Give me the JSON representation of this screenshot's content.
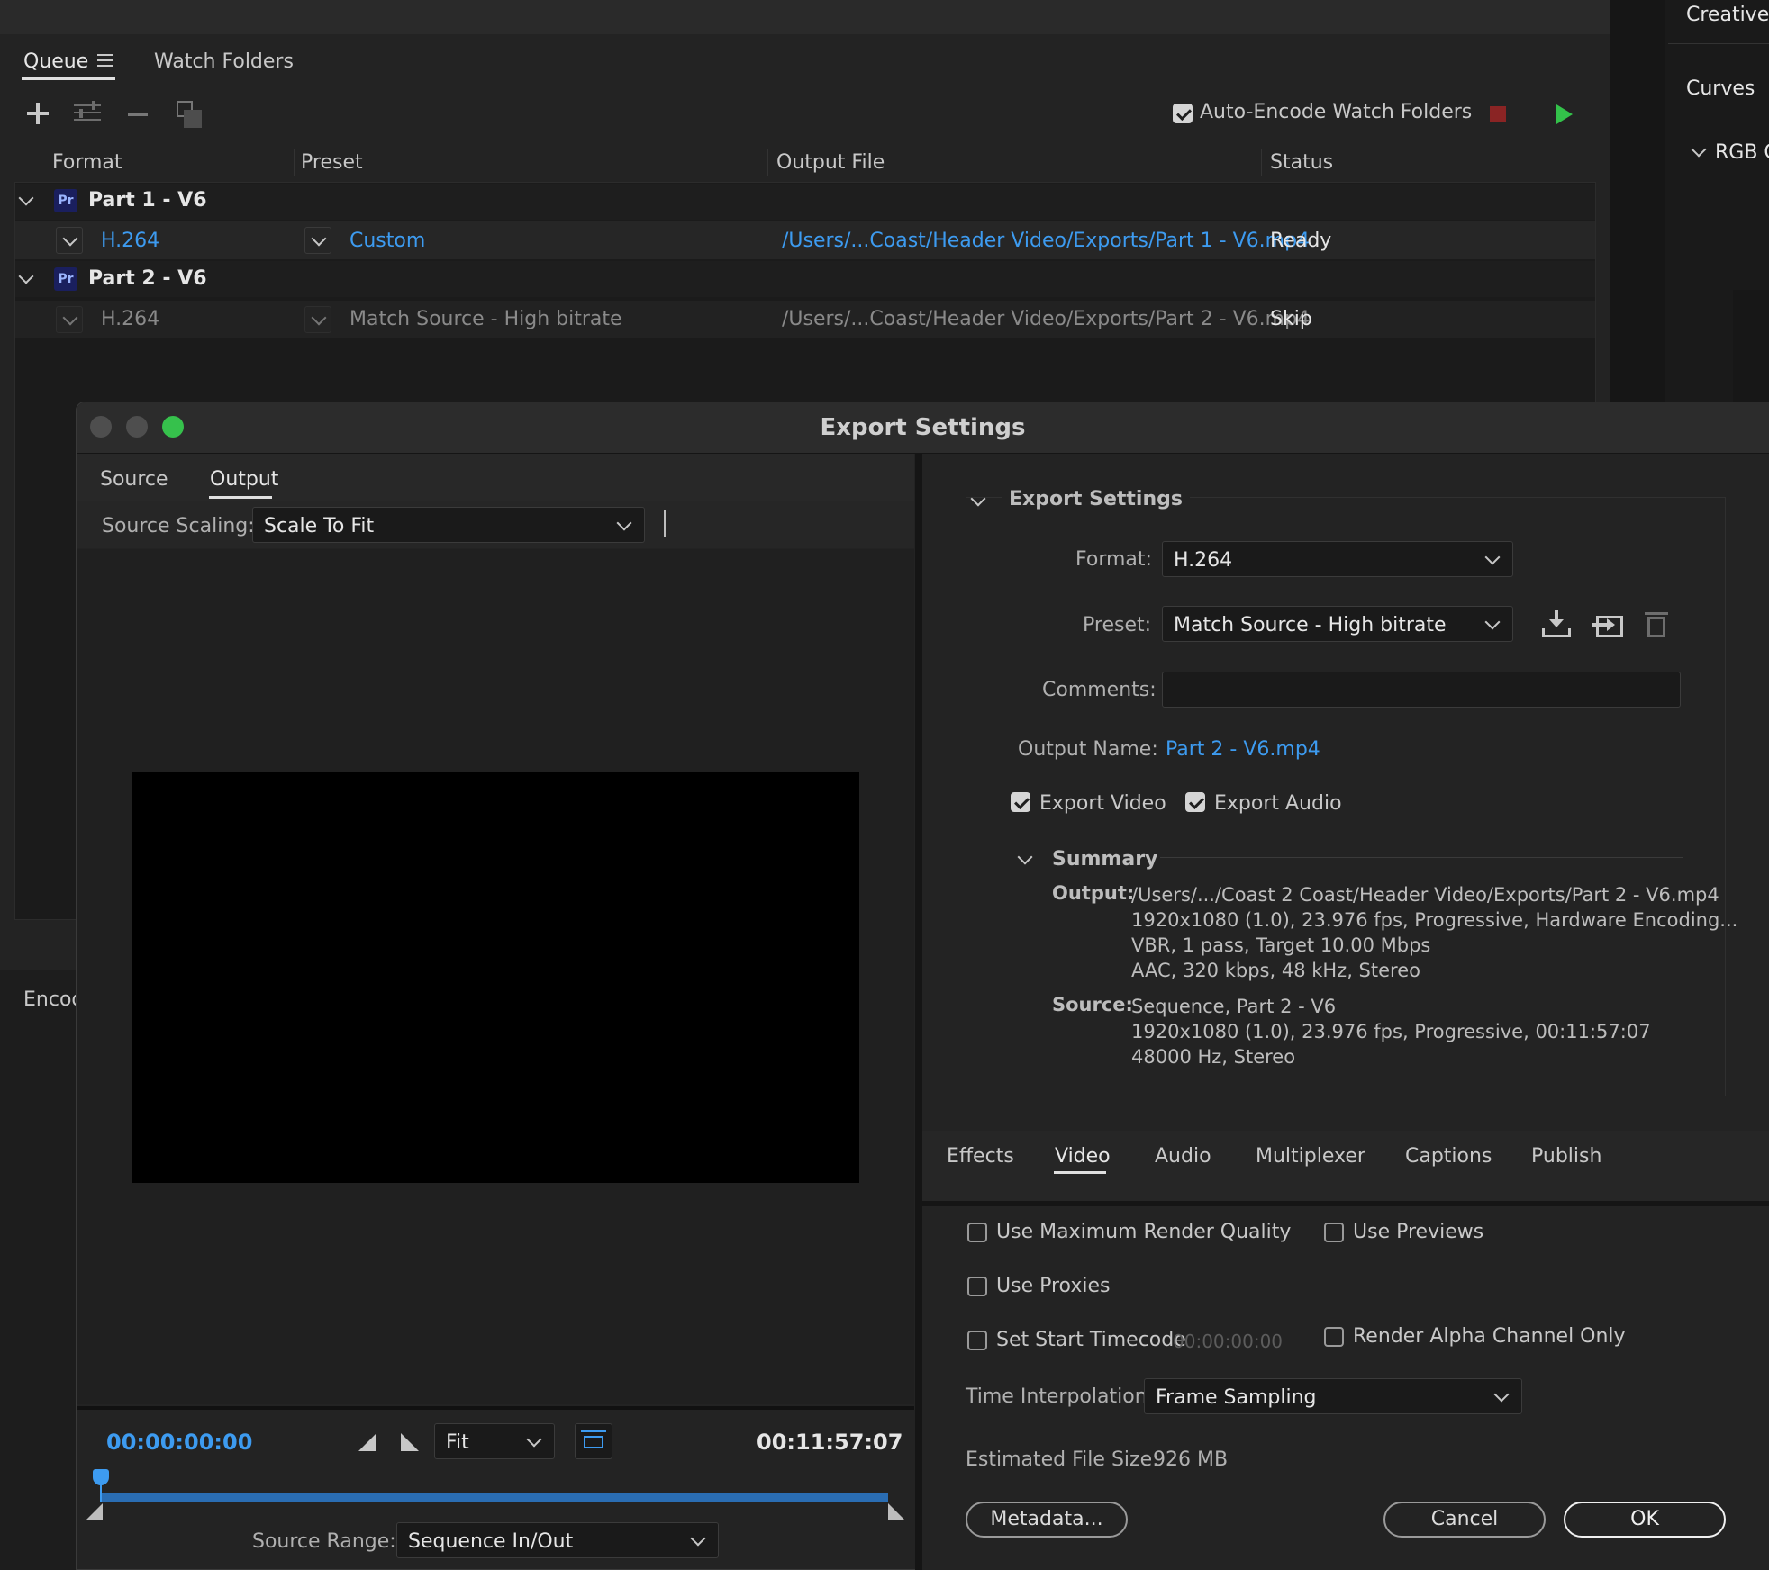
{
  "queue": {
    "tabs": [
      {
        "label": "Queue"
      },
      {
        "label": "Watch Folders"
      }
    ],
    "auto_encode_label": "Auto-Encode Watch Folders",
    "columns": {
      "format": "Format",
      "preset": "Preset",
      "output_file": "Output File",
      "status": "Status"
    },
    "items": [
      {
        "name": "Part 1 - V6",
        "format": "H.264",
        "preset": "Custom",
        "output": "/Users/...Coast/Header Video/Exports/Part 1 - V6.mp4",
        "status": "Ready"
      },
      {
        "name": "Part 2 - V6",
        "format": "H.264",
        "preset": "Match Source - High bitrate",
        "output": "/Users/...Coast/Header Video/Exports/Part 2 - V6.mp4",
        "status": "Skip"
      }
    ],
    "encoding_label": "Encod"
  },
  "right_panel": {
    "creative": "Creative",
    "curves": "Curves",
    "rgb": "RGB C"
  },
  "dialog": {
    "title": "Export Settings",
    "left_tabs": [
      {
        "label": "Source"
      },
      {
        "label": "Output"
      }
    ],
    "source_scaling_label": "Source Scaling:",
    "source_scaling_value": "Scale To Fit",
    "timecode_start": "00:00:00:00",
    "timecode_end": "00:11:57:07",
    "zoom_value": "Fit",
    "source_range_label": "Source Range:",
    "source_range_value": "Sequence In/Out",
    "settings": {
      "section_title": "Export Settings",
      "format_label": "Format:",
      "format_value": "H.264",
      "preset_label": "Preset:",
      "preset_value": "Match Source - High bitrate",
      "comments_label": "Comments:",
      "output_name_label": "Output Name:",
      "output_name_value": "Part 2 - V6.mp4",
      "export_video_label": "Export Video",
      "export_audio_label": "Export Audio",
      "summary_title": "Summary",
      "summary_output_label": "Output:",
      "summary_output_lines": [
        "/Users/.../Coast 2 Coast/Header Video/Exports/Part 2 - V6.mp4",
        "1920x1080 (1.0), 23.976 fps, Progressive, Hardware Encoding...",
        "VBR, 1 pass, Target 10.00 Mbps",
        "AAC, 320 kbps, 48 kHz, Stereo"
      ],
      "summary_source_label": "Source:",
      "summary_source_lines": [
        "Sequence, Part 2 - V6",
        "1920x1080 (1.0), 23.976 fps, Progressive, 00:11:57:07",
        "48000 Hz, Stereo"
      ]
    },
    "bottom_tabs": [
      {
        "label": "Effects"
      },
      {
        "label": "Video"
      },
      {
        "label": "Audio"
      },
      {
        "label": "Multiplexer"
      },
      {
        "label": "Captions"
      },
      {
        "label": "Publish"
      }
    ],
    "options": {
      "max_render_label": "Use Maximum Render Quality",
      "use_previews_label": "Use Previews",
      "use_proxies_label": "Use Proxies",
      "set_start_tc_label": "Set Start Timecode",
      "start_tc_value": "00:00:00:00",
      "render_alpha_label": "Render Alpha Channel Only",
      "time_interp_label": "Time Interpolation:",
      "time_interp_value": "Frame Sampling",
      "est_size_label": "Estimated File Size:",
      "est_size_value": "926 MB"
    },
    "buttons": {
      "metadata": "Metadata...",
      "cancel": "Cancel",
      "ok": "OK"
    }
  }
}
